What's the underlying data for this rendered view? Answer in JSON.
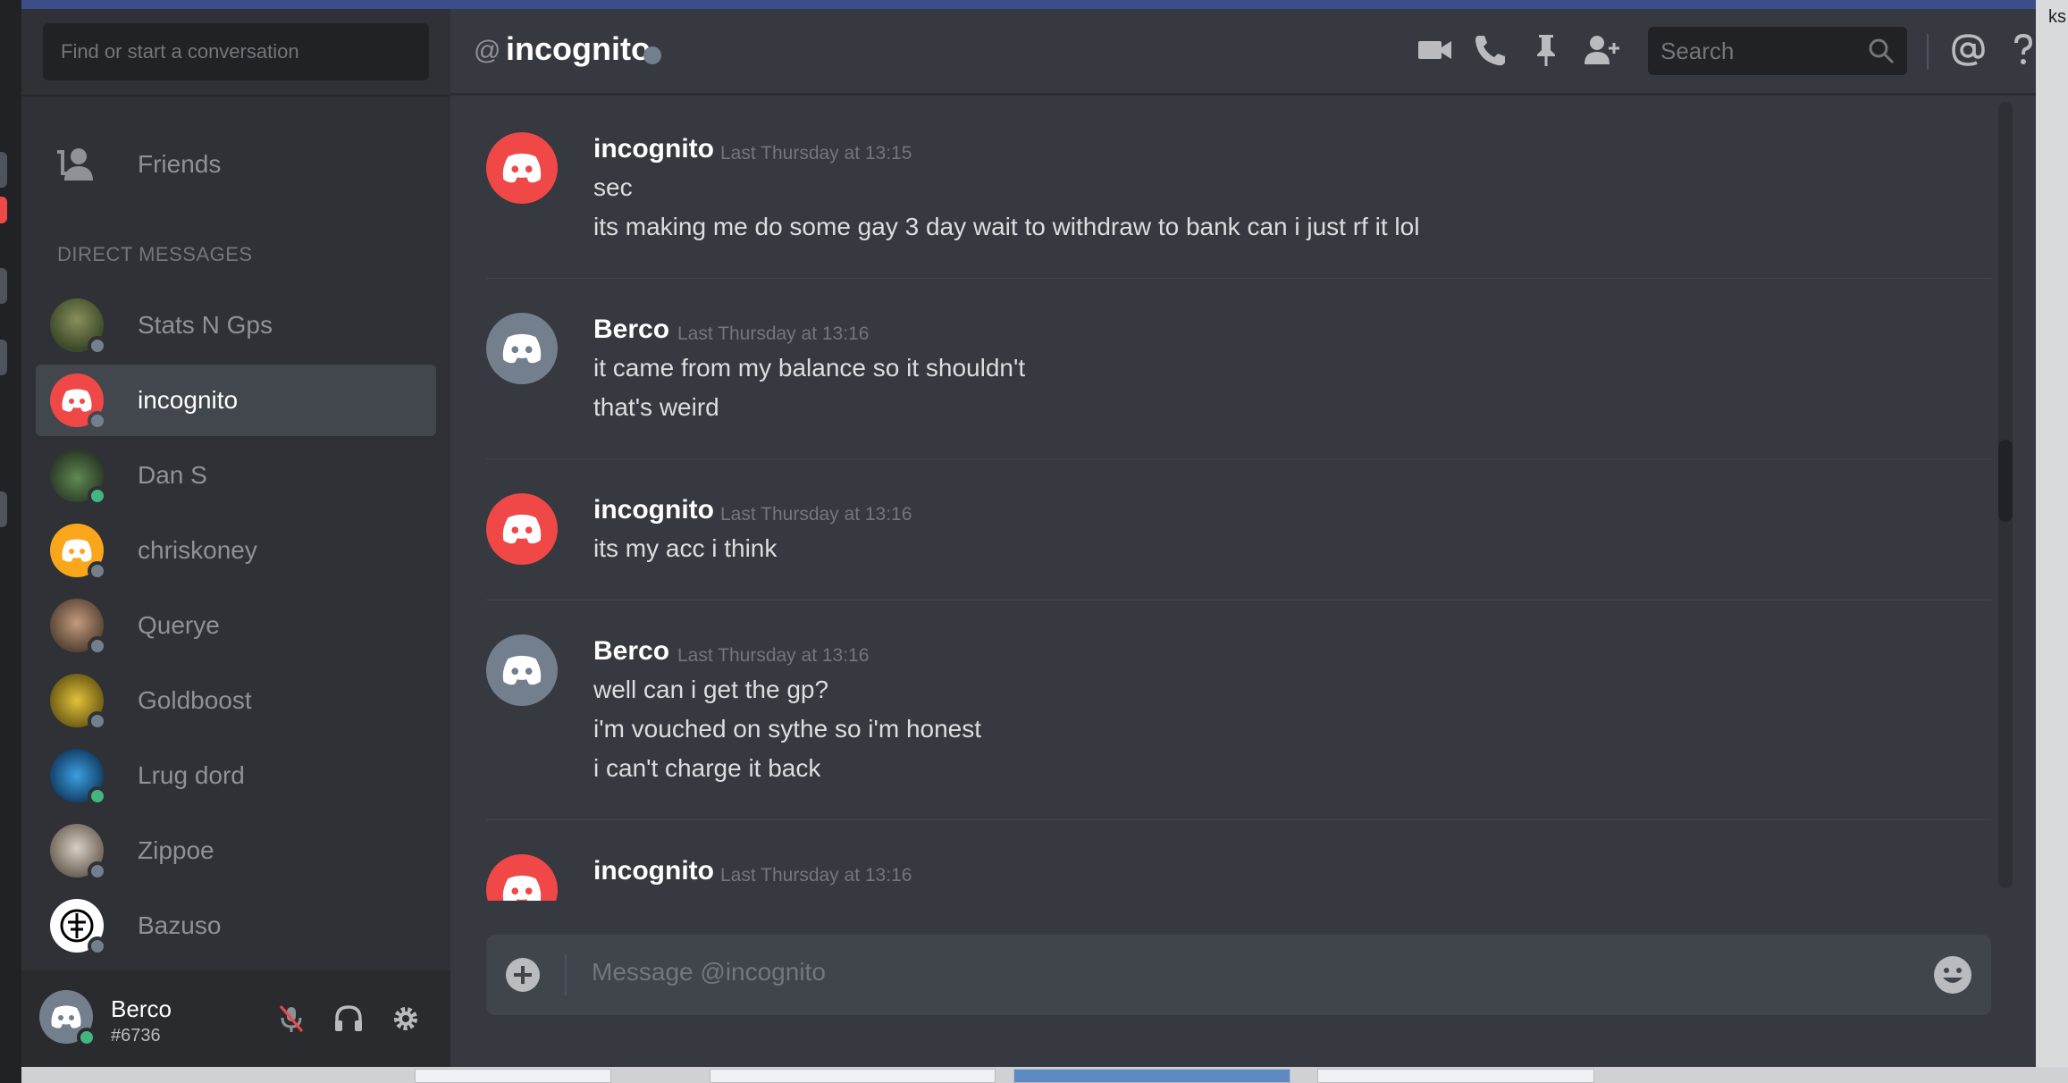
{
  "desktop": {
    "right_edge_text": "ks"
  },
  "sidebar": {
    "search_placeholder": "Find or start a conversation",
    "friends_label": "Friends",
    "dm_header": "DIRECT MESSAGES",
    "dms": [
      {
        "name": "Stats N Gps",
        "status": "offline",
        "avatar": "photo-avatar"
      },
      {
        "name": "incognito",
        "status": "offline",
        "avatar": "discord-red",
        "active": true
      },
      {
        "name": "Dan S",
        "status": "online",
        "avatar": "frog-avatar"
      },
      {
        "name": "chriskoney",
        "status": "offline",
        "avatar": "discord-orange"
      },
      {
        "name": "Querye",
        "status": "offline",
        "avatar": "photo-avatar"
      },
      {
        "name": "Goldboost",
        "status": "offline",
        "avatar": "gold-coins-avatar"
      },
      {
        "name": "Lrug dord",
        "status": "online",
        "avatar": "blue-logo-avatar"
      },
      {
        "name": "Zippoe",
        "status": "offline",
        "avatar": "photo-avatar"
      },
      {
        "name": "Bazuso",
        "status": "offline",
        "avatar": "emblem-avatar"
      }
    ]
  },
  "user": {
    "name": "Berco",
    "tag": "#6736",
    "status": "online"
  },
  "header": {
    "at_symbol": "@",
    "title": "incognito",
    "search_placeholder": "Search",
    "icons": [
      "video-call-icon",
      "voice-call-icon",
      "pin-icon",
      "add-friend-icon",
      "search-icon",
      "mentions-icon",
      "help-icon"
    ]
  },
  "messages": [
    {
      "author": "incognito",
      "time": "Last Thursday at 13:15",
      "avatar": "discord-red",
      "lines": [
        "sec",
        "its making me do some gay 3 day wait to withdraw to bank can i just rf it lol"
      ]
    },
    {
      "author": "Berco",
      "time": "Last Thursday at 13:16",
      "avatar": "discord-grey",
      "lines": [
        "it came from my balance so it shouldn't",
        "that's weird"
      ]
    },
    {
      "author": "incognito",
      "time": "Last Thursday at 13:16",
      "avatar": "discord-red",
      "lines": [
        "its my acc i think"
      ]
    },
    {
      "author": "Berco",
      "time": "Last Thursday at 13:16",
      "avatar": "discord-grey",
      "lines": [
        "well can i get the gp?",
        "i'm vouched on sythe so i'm honest",
        "i can't charge it back"
      ]
    },
    {
      "author": "incognito",
      "time": "Last Thursday at 13:16",
      "avatar": "discord-red",
      "lines": []
    }
  ],
  "composer": {
    "placeholder": "Message @incognito"
  },
  "colors": {
    "sidebar_bg": "#2f3136",
    "main_bg": "#36393f",
    "discord_red": "#f04747",
    "discord_orange": "#faa61a",
    "discord_grey": "#747f8d",
    "online": "#43b581",
    "offline": "#747f8d"
  }
}
